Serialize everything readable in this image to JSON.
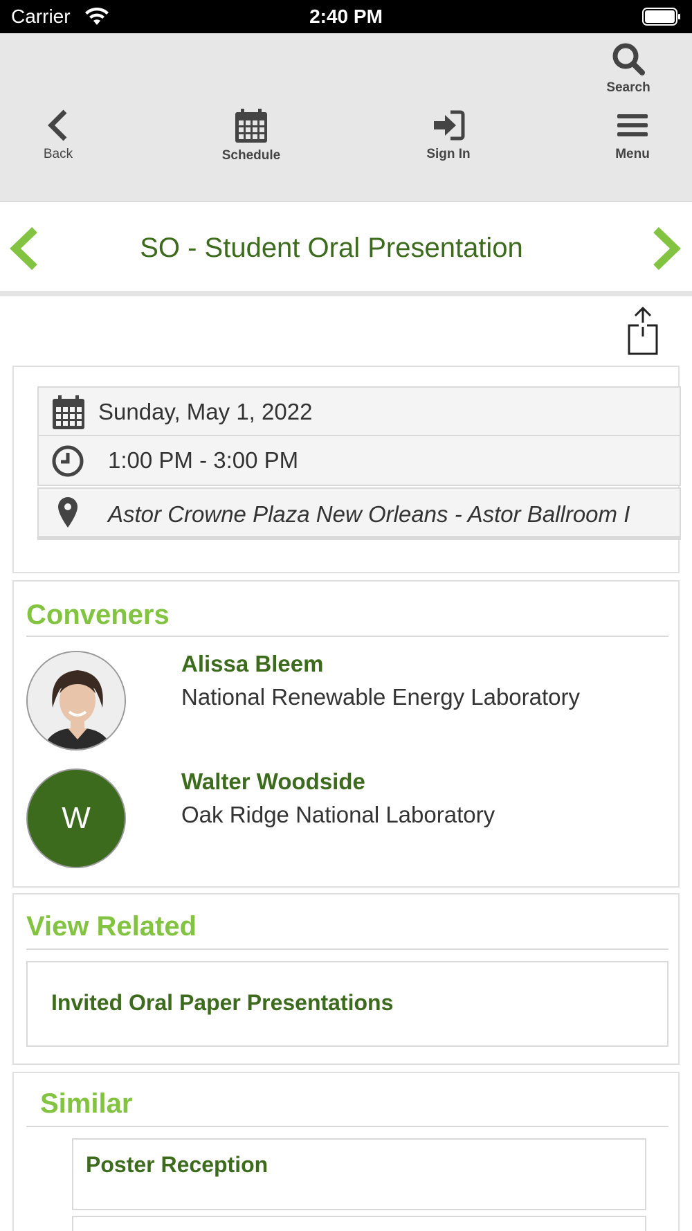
{
  "status_bar": {
    "carrier": "Carrier",
    "time": "2:40 PM"
  },
  "toolbar": {
    "search_label": "Search",
    "back_label": "Back",
    "schedule_label": "Schedule",
    "signin_label": "Sign In",
    "menu_label": "Menu"
  },
  "session": {
    "title": "SO - Student Oral Presentation",
    "date": "Sunday, May 1, 2022",
    "time": "1:00 PM - 3:00 PM",
    "location": "Astor Crowne Plaza New Orleans - Astor Ballroom I"
  },
  "conveners": {
    "heading": "Conveners",
    "people": [
      {
        "name": "Alissa Bleem",
        "org": "National Renewable Energy Laboratory",
        "initial": ""
      },
      {
        "name": "Walter Woodside",
        "org": "Oak Ridge National Laboratory",
        "initial": "W"
      }
    ]
  },
  "view_related": {
    "heading": "View Related",
    "items": [
      "Invited Oral Paper Presentations"
    ]
  },
  "similar": {
    "heading": "Similar",
    "items": [
      "Poster Reception"
    ]
  },
  "colors": {
    "accent_green": "#82c341",
    "dark_green": "#3d6b1e",
    "toolbar_bg": "#e7e7e7"
  }
}
